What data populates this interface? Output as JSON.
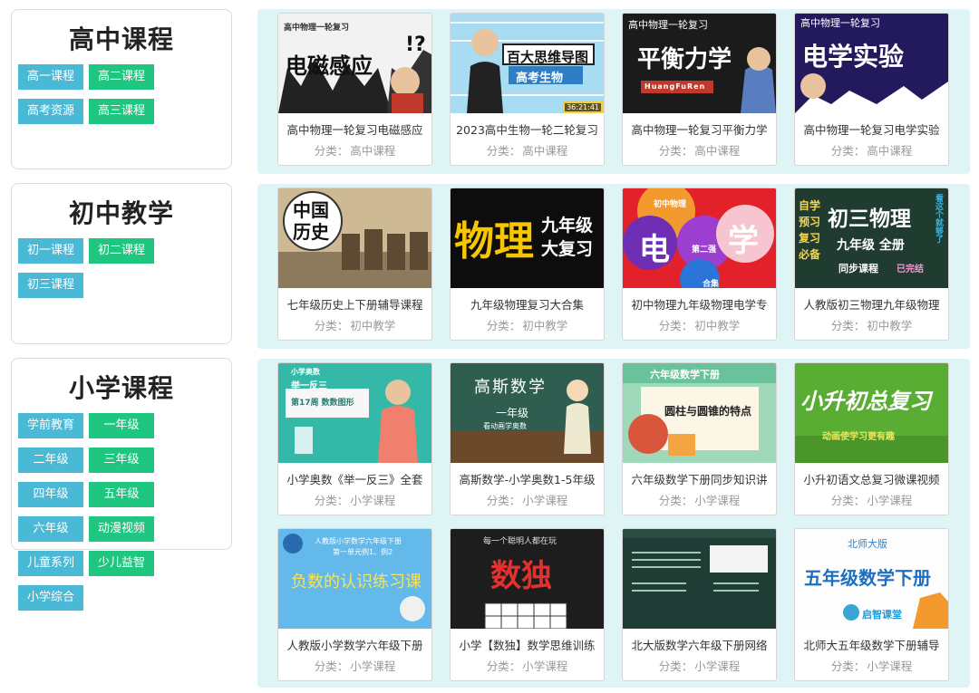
{
  "sections": [
    {
      "title": "高中课程",
      "tags": [
        {
          "label": "高一课程",
          "color": "teal"
        },
        {
          "label": "高二课程",
          "color": "green"
        },
        {
          "label": "高考资源",
          "color": "teal"
        },
        {
          "label": "高三课程",
          "color": "green"
        }
      ],
      "courses": [
        {
          "title": "高中物理一轮复习电磁感应",
          "category": "高中课程",
          "thumb_lines": [
            "高中物理一轮复习",
            "电磁感应",
            "!?"
          ]
        },
        {
          "title": "2023高中生物一轮二轮复习",
          "category": "高中课程",
          "thumb_lines": [
            "百大思维导图",
            "高考生物",
            "36:21:41"
          ]
        },
        {
          "title": "高中物理一轮复习平衡力学",
          "category": "高中课程",
          "thumb_lines": [
            "高中物理一轮复习",
            "平衡力学",
            "HuangFuRen"
          ]
        },
        {
          "title": "高中物理一轮复习电学实验",
          "category": "高中课程",
          "thumb_lines": [
            "高中物理一轮复习",
            "电学实验"
          ]
        }
      ]
    },
    {
      "title": "初中教学",
      "tags": [
        {
          "label": "初一课程",
          "color": "teal"
        },
        {
          "label": "初二课程",
          "color": "green"
        },
        {
          "label": "初三课程",
          "color": "teal"
        }
      ],
      "courses": [
        {
          "title": "七年级历史上下册辅导课程",
          "category": "初中教学",
          "thumb_lines": [
            "中国",
            "历史"
          ]
        },
        {
          "title": "九年级物理复习大合集",
          "category": "初中教学",
          "thumb_lines": [
            "物理",
            "九年级",
            "大复习"
          ]
        },
        {
          "title": "初中物理九年级物理电学专",
          "category": "初中教学",
          "thumb_lines": [
            "初中物理",
            "电",
            "学",
            "第二强",
            "合集"
          ]
        },
        {
          "title": "人教版初三物理九年级物理",
          "category": "初中教学",
          "thumb_lines": [
            "自学",
            "预习",
            "复习",
            "必备",
            "初三物理",
            "九年级 全册",
            "同步课程",
            "已完结",
            "看这个就够了"
          ]
        }
      ]
    },
    {
      "title": "小学课程",
      "tags": [
        {
          "label": "学前教育",
          "color": "teal"
        },
        {
          "label": "一年级",
          "color": "green"
        },
        {
          "label": "二年级",
          "color": "teal"
        },
        {
          "label": "三年级",
          "color": "green"
        },
        {
          "label": "四年级",
          "color": "teal"
        },
        {
          "label": "五年级",
          "color": "green"
        },
        {
          "label": "六年级",
          "color": "teal"
        },
        {
          "label": "动漫视频",
          "color": "green"
        },
        {
          "label": "儿童系列",
          "color": "teal"
        },
        {
          "label": "少儿益智",
          "color": "green"
        },
        {
          "label": "小学综合",
          "color": "teal"
        }
      ],
      "courses": [
        {
          "title": "小学奥数《举一反三》全套",
          "category": "小学课程",
          "thumb_lines": [
            "小学奥数",
            "举一反三",
            "第17周 数数图形"
          ]
        },
        {
          "title": "高斯数学-小学奥数1-5年级",
          "category": "小学课程",
          "thumb_lines": [
            "高斯数学",
            "一年级",
            "看动画学奥数"
          ]
        },
        {
          "title": "六年级数学下册同步知识讲",
          "category": "小学课程",
          "thumb_lines": [
            "六年级数学下册",
            "圆柱与圆锥的特点"
          ]
        },
        {
          "title": "小升初语文总复习微课视频",
          "category": "小学课程",
          "thumb_lines": [
            "小升初总复习",
            "动画使学习更有趣"
          ]
        },
        {
          "title": "人教版小学数学六年级下册",
          "category": "小学课程",
          "thumb_lines": [
            "人教版小学数学六年级下册",
            "第一单元例1、例2",
            "负数的认识练习课"
          ]
        },
        {
          "title": "小学【数独】数学思维训练",
          "category": "小学课程",
          "thumb_lines": [
            "每一个聪明人都在玩",
            "数独"
          ]
        },
        {
          "title": "北大版数学六年级下册网络",
          "category": "小学课程",
          "thumb_lines": []
        },
        {
          "title": "北师大五年级数学下册辅导",
          "category": "小学课程",
          "thumb_lines": [
            "北师大版",
            "五年级数学下册",
            "启智课堂"
          ]
        }
      ]
    }
  ],
  "category_label": "分类：",
  "colors": {
    "teal": "#4ab9d6",
    "green": "#1fc67f",
    "panel_bg": "#dff5f5"
  }
}
